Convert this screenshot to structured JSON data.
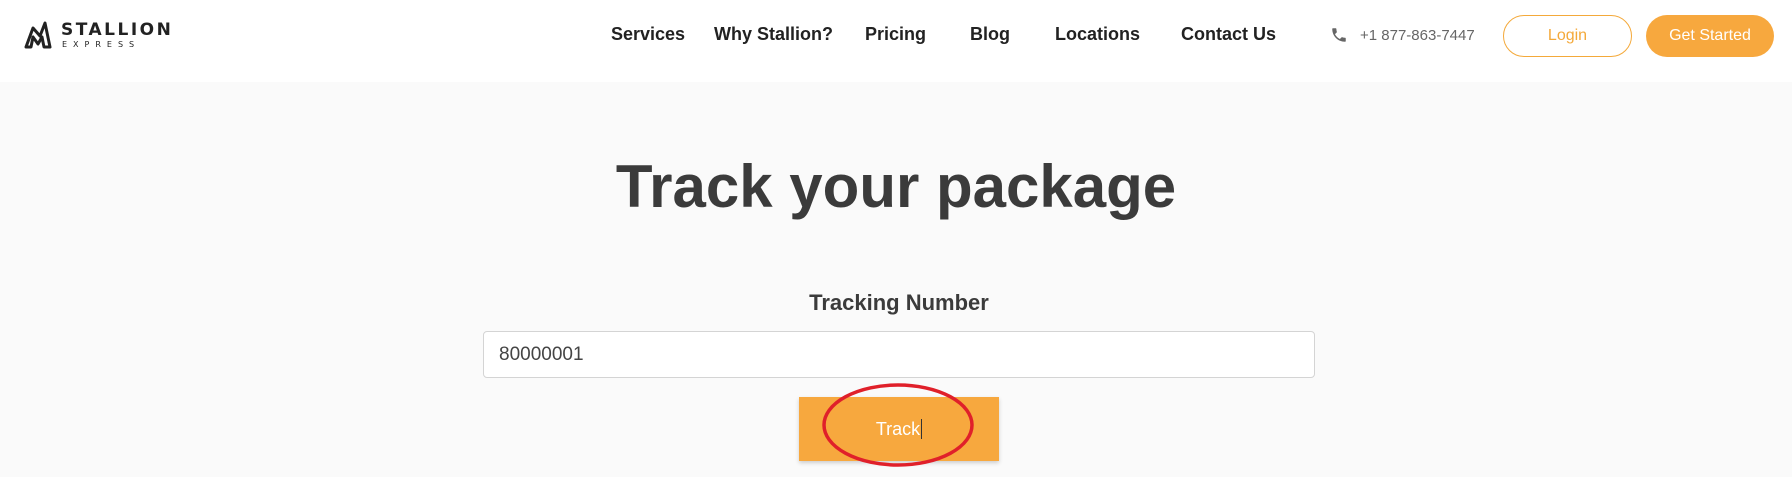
{
  "header": {
    "logo": {
      "name": "STALLION",
      "sub": "EXPRESS",
      "icon": "stallion-logo-icon"
    },
    "nav": [
      {
        "label": "Services"
      },
      {
        "label": "Why Stallion?"
      },
      {
        "label": "Pricing"
      },
      {
        "label": "Blog"
      },
      {
        "label": "Locations"
      },
      {
        "label": "Contact Us"
      }
    ],
    "phone": {
      "icon": "phone-icon",
      "number": "+1 877-863-7447"
    },
    "login_label": "Login",
    "get_started_label": "Get Started"
  },
  "main": {
    "title": "Track your package",
    "field_label": "Tracking Number",
    "tracking_value": "80000001",
    "track_label": "Track"
  },
  "colors": {
    "accent": "#f7a83e",
    "annotation": "#e0202a",
    "title_text": "#3b3b3b",
    "page_bg": "#fafafa"
  }
}
